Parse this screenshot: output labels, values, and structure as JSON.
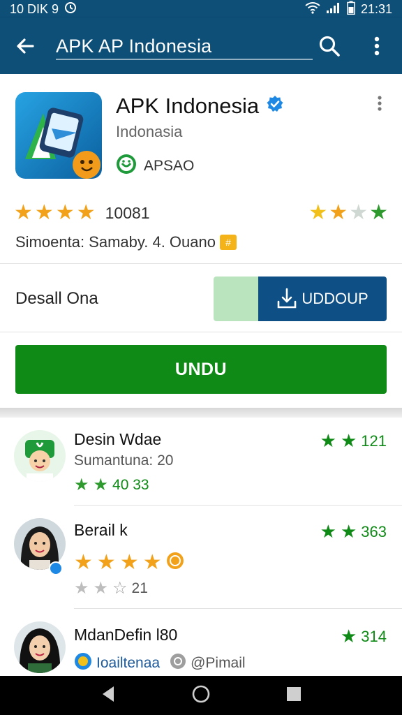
{
  "status_bar": {
    "left_text": "10 DIK 9",
    "time": "21:31"
  },
  "app_bar": {
    "title": "APK AP Indonesia"
  },
  "app": {
    "name": "APK Indonesia",
    "subtitle": "Indonasia",
    "developer": "APSAO",
    "rating_count": "10081",
    "summary": "Simoenta: Samaby. 4. Ouano",
    "summary_tag": "#"
  },
  "download": {
    "label": "Desall Ona",
    "button": "UDDOUP",
    "progress_fraction": 0.26
  },
  "install_button": "UNDU",
  "reviews": [
    {
      "name": "Desin Wdae",
      "sub": "Sumantuna: 20",
      "extra": "40 33",
      "right_value": "121"
    },
    {
      "name": "Berail k",
      "sub": "21",
      "extra": "",
      "right_value": "363"
    },
    {
      "name": "MdanDefin l80",
      "sub": "Ioailtenaa",
      "extra": "@Pimail",
      "right_value": "314"
    }
  ],
  "colors": {
    "primary": "#0e4f77",
    "accent_blue": "#0e4f86",
    "green": "#0f8a16",
    "light_green": "#b9e4be",
    "star_orange": "#f2a21a",
    "star_green": "#2e9a2e"
  },
  "icons": {
    "back": "arrow-left",
    "search": "magnifier",
    "more": "vertical-dots",
    "verified": "verified-badge"
  }
}
